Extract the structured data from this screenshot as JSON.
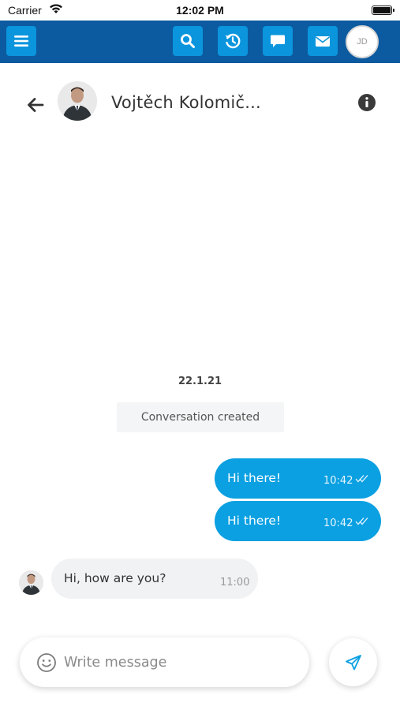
{
  "status_bar": {
    "carrier": "Carrier",
    "time": "12:02 PM",
    "battery_level": 1.0
  },
  "top_nav": {
    "background_color": "#0c5aa0",
    "button_color": "#0b95dd",
    "buttons": [
      {
        "icon": "menu-icon"
      },
      {
        "icon": "search-icon"
      },
      {
        "icon": "history-icon"
      },
      {
        "icon": "chat-icon"
      },
      {
        "icon": "mail-icon"
      }
    ],
    "user_initials": "JD"
  },
  "chat_header": {
    "back_icon": "arrow-left-icon",
    "contact_name": "Vojtěch Kolomič...",
    "info_icon": "info-icon"
  },
  "conversation": {
    "date": "22.1.21",
    "system_message": "Conversation created",
    "accent_color": "#0aa0e2",
    "messages": [
      {
        "direction": "outgoing",
        "text": "Hi there!",
        "time": "10:42",
        "status": "read"
      },
      {
        "direction": "outgoing",
        "text": "Hi there!",
        "time": "10:42",
        "status": "read"
      },
      {
        "direction": "incoming",
        "text": "Hi, how are you?",
        "time": "11:00"
      }
    ]
  },
  "composer": {
    "placeholder": "Write message",
    "emoji_icon": "emoji-icon",
    "send_icon": "send-icon"
  }
}
